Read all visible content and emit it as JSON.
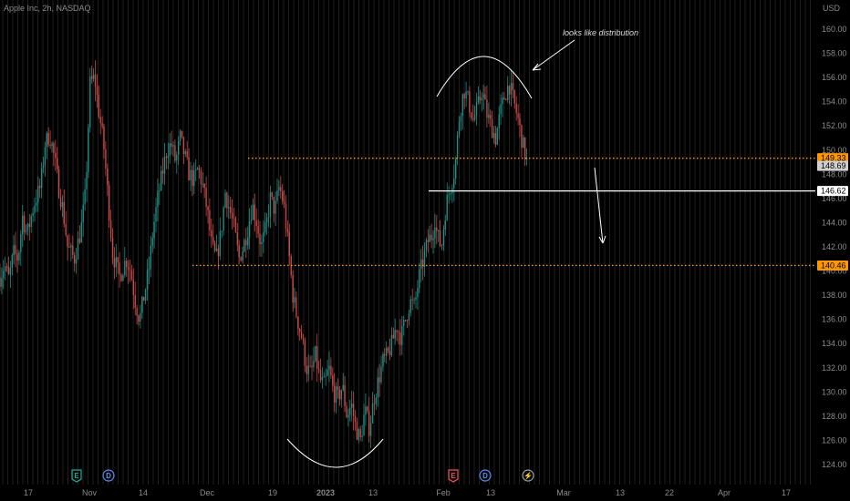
{
  "header": {
    "symbol": "Apple Inc, 2h, NASDAQ",
    "currency": "USD"
  },
  "chart_data": {
    "type": "candlestick",
    "title": "Apple Inc, 2h, NASDAQ",
    "ylabel": "USD",
    "ylim": [
      122.8,
      163.2
    ],
    "y_ticks": [
      124,
      126,
      128,
      130,
      132,
      134,
      136,
      138,
      140,
      142,
      144,
      146,
      148,
      150,
      152,
      154,
      156,
      158,
      160
    ],
    "x_ticks": [
      "17",
      "Nov",
      "14",
      "Dec",
      "19",
      "2023",
      "13",
      "Feb",
      "13",
      "Mar",
      "13",
      "22",
      "Apr",
      "17"
    ],
    "price_path": [
      [
        0,
        139.5
      ],
      [
        0.01,
        140.5
      ],
      [
        0.02,
        139.3
      ],
      [
        0.03,
        141.5
      ],
      [
        0.04,
        141
      ],
      [
        0.05,
        144.5
      ],
      [
        0.06,
        143
      ],
      [
        0.075,
        145.5
      ],
      [
        0.09,
        147
      ],
      [
        0.1,
        150.5
      ],
      [
        0.11,
        151.3
      ],
      [
        0.12,
        149.5
      ],
      [
        0.13,
        147
      ],
      [
        0.14,
        145
      ],
      [
        0.15,
        142
      ],
      [
        0.165,
        141
      ],
      [
        0.18,
        143.5
      ],
      [
        0.19,
        146.5
      ],
      [
        0.2,
        155.5
      ],
      [
        0.21,
        156
      ],
      [
        0.22,
        153
      ],
      [
        0.23,
        150.5
      ],
      [
        0.24,
        146
      ],
      [
        0.25,
        141.5
      ],
      [
        0.265,
        139.5
      ],
      [
        0.28,
        141
      ],
      [
        0.29,
        140
      ],
      [
        0.3,
        137.5
      ],
      [
        0.31,
        136
      ],
      [
        0.32,
        138
      ],
      [
        0.33,
        140
      ],
      [
        0.34,
        143.5
      ],
      [
        0.35,
        146
      ],
      [
        0.36,
        148
      ],
      [
        0.37,
        150
      ],
      [
        0.38,
        150.5
      ],
      [
        0.39,
        149
      ],
      [
        0.4,
        151
      ],
      [
        0.41,
        149.5
      ],
      [
        0.42,
        148
      ],
      [
        0.43,
        147.5
      ],
      [
        0.44,
        148.5
      ],
      [
        0.45,
        147
      ],
      [
        0.46,
        145
      ],
      [
        0.47,
        142
      ],
      [
        0.48,
        141
      ],
      [
        0.49,
        143
      ],
      [
        0.5,
        146.5
      ],
      [
        0.51,
        145
      ],
      [
        0.52,
        143.5
      ],
      [
        0.53,
        141
      ],
      [
        0.54,
        142
      ],
      [
        0.55,
        143.5
      ],
      [
        0.56,
        145.5
      ],
      [
        0.57,
        144
      ],
      [
        0.58,
        142
      ],
      [
        0.59,
        143.5
      ],
      [
        0.6,
        146
      ],
      [
        0.61,
        145
      ],
      [
        0.62,
        147
      ],
      [
        0.63,
        145.5
      ],
      [
        0.64,
        142
      ],
      [
        0.65,
        138
      ],
      [
        0.66,
        136
      ],
      [
        0.67,
        134.5
      ],
      [
        0.68,
        132
      ],
      [
        0.69,
        131.5
      ],
      [
        0.7,
        133
      ],
      [
        0.71,
        131
      ],
      [
        0.72,
        130.5
      ],
      [
        0.73,
        132
      ],
      [
        0.74,
        130
      ],
      [
        0.75,
        129.5
      ],
      [
        0.76,
        130.5
      ],
      [
        0.77,
        128
      ],
      [
        0.78,
        129
      ],
      [
        0.79,
        127
      ],
      [
        0.8,
        126
      ],
      [
        0.81,
        128.5
      ],
      [
        0.82,
        127
      ],
      [
        0.83,
        129.5
      ],
      [
        0.84,
        131
      ],
      [
        0.85,
        132.5
      ],
      [
        0.86,
        133
      ],
      [
        0.87,
        134
      ],
      [
        0.88,
        135.5
      ],
      [
        0.89,
        134.5
      ],
      [
        0.9,
        136
      ],
      [
        0.91,
        137.5
      ],
      [
        0.92,
        137
      ],
      [
        0.93,
        139.5
      ],
      [
        0.94,
        141
      ],
      [
        0.95,
        142.5
      ],
      [
        0.96,
        143
      ],
      [
        0.965,
        144.5
      ],
      [
        0.97,
        143
      ],
      [
        0.98,
        142
      ],
      [
        0.99,
        145.5
      ],
      [
        1.0,
        147
      ],
      [
        1.01,
        148.5
      ],
      [
        1.02,
        153
      ],
      [
        1.03,
        155
      ],
      [
        1.04,
        154
      ],
      [
        1.05,
        152.5
      ],
      [
        1.06,
        153.5
      ],
      [
        1.07,
        155
      ],
      [
        1.08,
        153
      ],
      [
        1.09,
        152
      ],
      [
        1.1,
        151
      ],
      [
        1.11,
        153
      ],
      [
        1.12,
        154.5
      ],
      [
        1.13,
        155.5
      ],
      [
        1.14,
        154
      ],
      [
        1.15,
        152.5
      ],
      [
        1.16,
        150.5
      ],
      [
        1.17,
        149
      ]
    ],
    "levels": [
      {
        "price": 149.33,
        "label": "149.33",
        "style": "dotted",
        "color": "#ff9800"
      },
      {
        "price": 146.62,
        "label": "146.62",
        "style": "solid",
        "color": "#ffffff"
      },
      {
        "price": 140.46,
        "label": "140.46",
        "style": "dotted",
        "color": "#ff9800"
      }
    ],
    "last_price": {
      "value": 148.69,
      "label": "148.69"
    },
    "annotation": "looks like distribution",
    "events": [
      {
        "type": "earnings",
        "letter": "E"
      },
      {
        "type": "dividend",
        "letter": "D"
      },
      {
        "type": "earnings",
        "letter": "E"
      },
      {
        "type": "dividend",
        "letter": "D"
      },
      {
        "type": "split",
        "letter": "⚡"
      }
    ]
  }
}
